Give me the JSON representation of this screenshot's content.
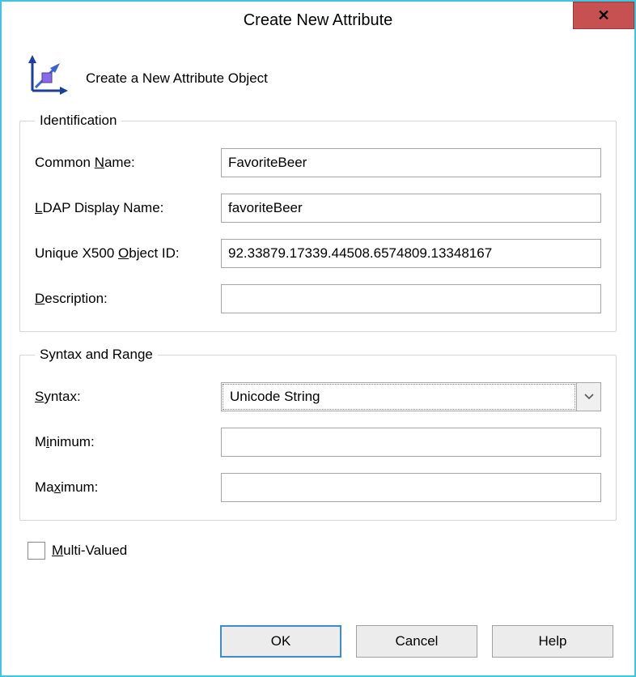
{
  "window": {
    "title": "Create New Attribute",
    "subtitle": "Create a New Attribute Object"
  },
  "identification": {
    "legend": "Identification",
    "common_name_label": "Common Name:",
    "common_name_value": "FavoriteBeer",
    "ldap_label": "LDAP Display Name:",
    "ldap_value": "favoriteBeer",
    "oid_label": "Unique X500 Object ID:",
    "oid_value": "92.33879.17339.44508.6574809.13348167",
    "description_label": "Description:",
    "description_value": ""
  },
  "syntax": {
    "legend": "Syntax and Range",
    "syntax_label": "Syntax:",
    "syntax_value": "Unicode String",
    "minimum_label": "Minimum:",
    "minimum_value": "",
    "maximum_label": "Maximum:",
    "maximum_value": ""
  },
  "multi_valued": {
    "label": "Multi-Valued",
    "checked": false
  },
  "buttons": {
    "ok": "OK",
    "cancel": "Cancel",
    "help": "Help"
  }
}
